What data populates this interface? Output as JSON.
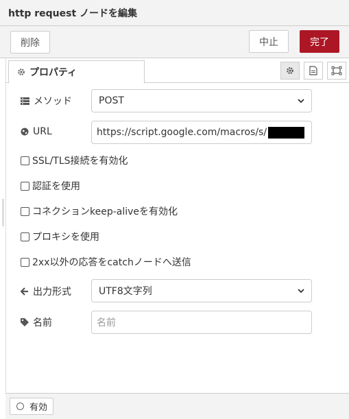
{
  "window": {
    "title": "http request ノードを編集"
  },
  "toolbar": {
    "delete_label": "削除",
    "cancel_label": "中止",
    "done_label": "完了"
  },
  "tabs": {
    "properties_label": "プロパティ"
  },
  "form": {
    "method": {
      "label": "メソッド",
      "value": "POST"
    },
    "url": {
      "label": "URL",
      "value": "https://script.google.com/macros/s/"
    },
    "checkboxes": [
      {
        "label": "SSL/TLS接続を有効化",
        "checked": false
      },
      {
        "label": "認証を使用",
        "checked": false
      },
      {
        "label": "コネクションkeep-aliveを有効化",
        "checked": false
      },
      {
        "label": "プロキシを使用",
        "checked": false
      },
      {
        "label": "2xx以外の応答をcatchノードへ送信",
        "checked": false
      }
    ],
    "output": {
      "label": "出力形式",
      "value": "UTF8文字列"
    },
    "name": {
      "label": "名前",
      "placeholder": "名前",
      "value": ""
    }
  },
  "footer": {
    "enable_label": "有効"
  },
  "colors": {
    "done_button": "#ad1625"
  }
}
